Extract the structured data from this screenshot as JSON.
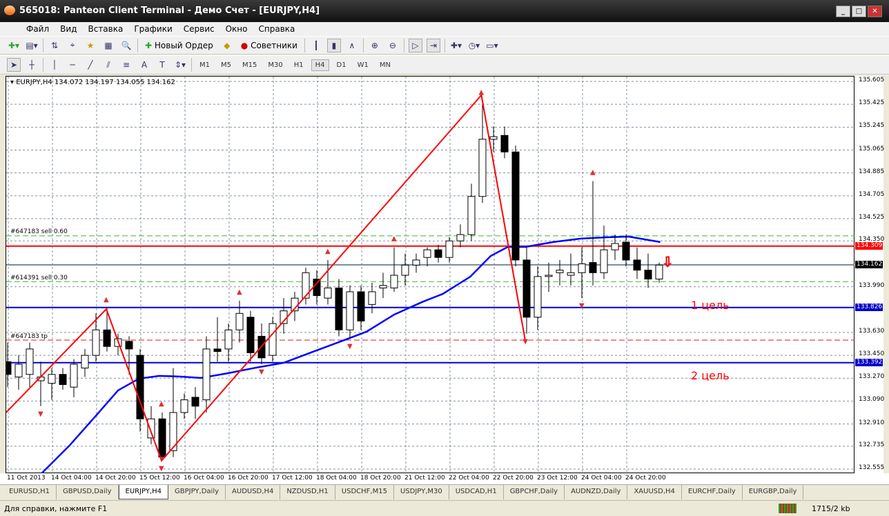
{
  "window": {
    "title": "565018: Panteon Client Terminal - Демо Счет - [EURJPY,H4]",
    "buttons": [
      "_",
      "□",
      "✕"
    ]
  },
  "menu": [
    "Файл",
    "Вид",
    "Вставка",
    "Графики",
    "Сервис",
    "Окно",
    "Справка"
  ],
  "toolbar": {
    "new_order": "Новый Ордер",
    "experts": "Советники"
  },
  "timeframes": [
    "M1",
    "M5",
    "M15",
    "M30",
    "H1",
    "H4",
    "D1",
    "W1",
    "MN"
  ],
  "active_timeframe": "H4",
  "chart": {
    "header": "EURJPY,H4  134.072 134.197 134.055 134.162",
    "price_ticks": [
      "135.605",
      "135.425",
      "135.245",
      "135.065",
      "134.885",
      "134.705",
      "134.525",
      "134.350",
      "133.990",
      "133.630",
      "133.450",
      "133.270",
      "133.090",
      "132.910",
      "132.735",
      "132.555"
    ],
    "price_min": 132.555,
    "price_max": 135.605,
    "time_labels": [
      "11 Oct 2013",
      "14 Oct 04:00",
      "14 Oct 20:00",
      "15 Oct 12:00",
      "16 Oct 04:00",
      "16 Oct 20:00",
      "17 Oct 12:00",
      "18 Oct 04:00",
      "18 Oct 20:00",
      "21 Oct 12:00",
      "22 Oct 04:00",
      "22 Oct 20:00",
      "23 Oct 12:00",
      "24 Oct 04:00",
      "24 Oct 20:00"
    ],
    "candles": [
      [
        133.4,
        133.55,
        133.2,
        133.3
      ],
      [
        133.28,
        133.45,
        133.18,
        133.38
      ],
      [
        133.3,
        133.55,
        133.2,
        133.5
      ],
      [
        133.25,
        133.4,
        133.05,
        133.28
      ],
      [
        133.23,
        133.35,
        133.1,
        133.3
      ],
      [
        133.3,
        133.35,
        133.18,
        133.22
      ],
      [
        133.2,
        133.42,
        133.12,
        133.38
      ],
      [
        133.35,
        133.5,
        133.28,
        133.45
      ],
      [
        133.45,
        133.78,
        133.4,
        133.65
      ],
      [
        133.65,
        133.82,
        133.48,
        133.52
      ],
      [
        133.52,
        133.62,
        133.45,
        133.58
      ],
      [
        133.56,
        133.6,
        133.3,
        133.5
      ],
      [
        133.45,
        133.5,
        132.85,
        132.95
      ],
      [
        132.8,
        133.05,
        132.75,
        132.95
      ],
      [
        132.95,
        133.0,
        132.62,
        132.65
      ],
      [
        132.7,
        133.35,
        132.65,
        133.0
      ],
      [
        133.0,
        133.15,
        132.95,
        133.1
      ],
      [
        133.12,
        133.2,
        132.95,
        133.05
      ],
      [
        133.1,
        133.6,
        133.0,
        133.5
      ],
      [
        133.5,
        133.75,
        133.4,
        133.48
      ],
      [
        133.5,
        133.7,
        133.4,
        133.65
      ],
      [
        133.65,
        133.88,
        133.55,
        133.78
      ],
      [
        133.75,
        133.8,
        133.4,
        133.47
      ],
      [
        133.6,
        133.7,
        133.38,
        133.43
      ],
      [
        133.45,
        133.75,
        133.4,
        133.7
      ],
      [
        133.7,
        133.9,
        133.62,
        133.8
      ],
      [
        133.8,
        133.95,
        133.72,
        133.9
      ],
      [
        133.9,
        134.14,
        133.85,
        134.1
      ],
      [
        134.05,
        134.12,
        133.85,
        133.92
      ],
      [
        133.9,
        134.2,
        133.85,
        133.98
      ],
      [
        133.98,
        134.05,
        133.6,
        133.65
      ],
      [
        133.65,
        134.0,
        133.58,
        133.95
      ],
      [
        133.95,
        134.0,
        133.65,
        133.72
      ],
      [
        133.85,
        134.02,
        133.78,
        133.95
      ],
      [
        133.98,
        134.1,
        133.9,
        134.0
      ],
      [
        133.98,
        134.3,
        133.95,
        134.08
      ],
      [
        134.08,
        134.25,
        134.0,
        134.16
      ],
      [
        134.16,
        134.25,
        134.1,
        134.2
      ],
      [
        134.22,
        134.3,
        134.15,
        134.28
      ],
      [
        134.28,
        134.32,
        134.18,
        134.22
      ],
      [
        134.22,
        134.38,
        134.18,
        134.35
      ],
      [
        134.35,
        134.48,
        134.3,
        134.4
      ],
      [
        134.4,
        134.8,
        134.35,
        134.7
      ],
      [
        134.7,
        135.45,
        134.65,
        135.15
      ],
      [
        135.15,
        135.25,
        135.05,
        135.17
      ],
      [
        135.18,
        135.25,
        135.0,
        135.05
      ],
      [
        135.05,
        135.1,
        134.15,
        134.2
      ],
      [
        134.2,
        134.3,
        133.62,
        133.75
      ],
      [
        133.75,
        134.15,
        133.65,
        134.07
      ],
      [
        134.07,
        134.18,
        133.95,
        134.08
      ],
      [
        134.1,
        134.2,
        134.0,
        134.12
      ],
      [
        134.08,
        134.25,
        134.0,
        134.1
      ],
      [
        134.1,
        134.3,
        133.9,
        134.17
      ],
      [
        134.18,
        134.82,
        134.0,
        134.1
      ],
      [
        134.1,
        134.47,
        134.05,
        134.28
      ],
      [
        134.28,
        134.4,
        134.2,
        134.33
      ],
      [
        134.34,
        134.4,
        134.15,
        134.2
      ],
      [
        134.2,
        134.3,
        134.05,
        134.12
      ],
      [
        134.12,
        134.25,
        133.98,
        134.05
      ],
      [
        134.05,
        134.18,
        134.02,
        134.16
      ]
    ],
    "ma": [
      [
        3.1,
        132.523
      ],
      [
        5.6,
        132.74
      ],
      [
        8.1,
        132.985
      ],
      [
        10,
        133.174
      ],
      [
        11.9,
        133.267
      ],
      [
        13.75,
        133.288
      ],
      [
        15.6,
        133.283
      ],
      [
        17.5,
        133.272
      ],
      [
        20,
        133.31
      ],
      [
        22.5,
        133.353
      ],
      [
        25,
        133.391
      ],
      [
        27.5,
        133.473
      ],
      [
        30,
        133.554
      ],
      [
        32.5,
        133.636
      ],
      [
        35,
        133.77
      ],
      [
        37.5,
        133.868
      ],
      [
        39.4,
        133.933
      ],
      [
        41.9,
        134.069
      ],
      [
        43.75,
        134.232
      ],
      [
        45.3,
        134.303
      ],
      [
        46.9,
        134.303
      ],
      [
        49.4,
        134.341
      ],
      [
        51.9,
        134.368
      ],
      [
        54.4,
        134.379
      ],
      [
        56.25,
        134.384
      ],
      [
        59.1,
        134.341
      ]
    ],
    "zigzag": [
      [
        -0.125,
        133.001
      ],
      [
        8.94,
        133.814
      ],
      [
        13.94,
        132.621
      ],
      [
        42.9,
        135.497
      ],
      [
        46.9,
        133.554
      ]
    ],
    "lines": [
      {
        "price": 134.309,
        "color": "#ff0000",
        "style": "solid",
        "tag": "134.309"
      },
      {
        "price": 134.162,
        "color": "#778899",
        "style": "solid",
        "tag": "134.162",
        "tagcolor": "#000000"
      },
      {
        "price": 133.826,
        "color": "#0000cc",
        "style": "solid",
        "tag": "133.826"
      },
      {
        "price": 133.392,
        "color": "#0000cc",
        "style": "solid",
        "tag": "133.392"
      },
      {
        "price": 134.39,
        "color": "#33bb33",
        "style": "dash",
        "label": "#647183 sell 0.60"
      },
      {
        "price": 134.03,
        "color": "#33bb33",
        "style": "dash",
        "label": "#614391 sell 0.30"
      },
      {
        "price": 133.57,
        "color": "#cc2222",
        "style": "dash",
        "label": "#647183 tp"
      }
    ],
    "targets": [
      {
        "text": "1 цель",
        "price": 133.826
      },
      {
        "text": "2 цель",
        "price": 133.26
      }
    ],
    "fractal_up": [
      8.94,
      13.94,
      21,
      29,
      35,
      42.9,
      53
    ],
    "fractal_down": [
      3,
      13.94,
      23,
      31,
      46.9,
      52
    ]
  },
  "tabs": [
    "EURUSD,H1",
    "GBPUSD,Daily",
    "EURJPY,H4",
    "GBPJPY,Daily",
    "AUDUSD,H4",
    "NZDUSD,H1",
    "USDCHF,M15",
    "USDJPY,M30",
    "USDCAD,H1",
    "GBPCHF,Daily",
    "AUDNZD,Daily",
    "XAUUSD,H4",
    "EURCHF,Daily",
    "EURGBP,Daily"
  ],
  "active_tab": "EURJPY,H4",
  "status": {
    "help": "Для справки, нажмите F1",
    "traffic": "1715/2 kb"
  }
}
